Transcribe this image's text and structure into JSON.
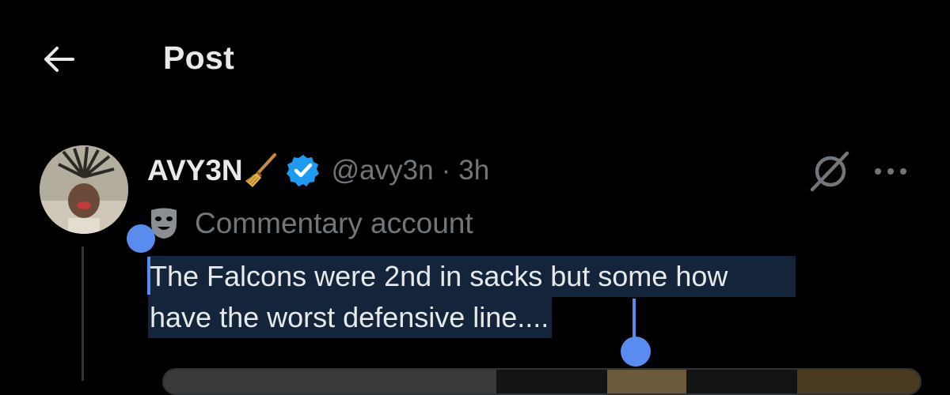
{
  "header": {
    "title": "Post"
  },
  "post": {
    "author": {
      "display_name": "AVY3N",
      "name_emoji": "broom",
      "verified": true,
      "handle": "@avy3n",
      "separator": "·",
      "time": "3h"
    },
    "account_label": {
      "icon": "theater-mask-icon",
      "text": "Commentary account"
    },
    "text_line_1": "The Falcons were 2nd in sacks but some how",
    "text_line_2": "have the worst defensive line...."
  },
  "icons": {
    "back": "arrow-left-icon",
    "grok": "grok-icon",
    "more": "more-icon",
    "verified": "verified-badge-icon"
  },
  "colors": {
    "background": "#000000",
    "text_primary": "#e7e9ea",
    "text_secondary": "#71767b",
    "accent_verified": "#1d9bf0",
    "selection": "#5a8cf0",
    "selection_bg": "#14253b"
  }
}
